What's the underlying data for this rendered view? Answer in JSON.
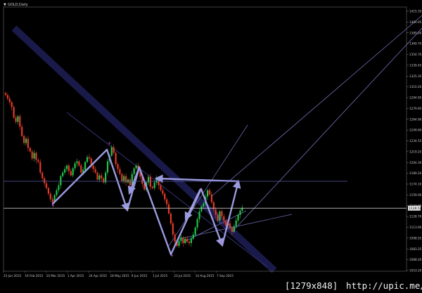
{
  "window": {
    "title": "GOLD,Daily",
    "menu_glyph": "▼"
  },
  "colors": {
    "background": "#000000",
    "bull": "#22c24a",
    "bear": "#e23a2a",
    "pattern": "#9a9adf",
    "trendline": "#34347a",
    "grid": "#dcdcdc"
  },
  "price_axis": {
    "current_price": "1139.53",
    "ticks": [
      "1415.35",
      "1400.05",
      "1385.00",
      "1369.70",
      "1354.70",
      "1339.45",
      "1325.35",
      "1310.20",
      "1294.95",
      "1279.95",
      "1264.90",
      "1249.60",
      "1234.55",
      "1219.25",
      "1204.30",
      "1189.20",
      "1174.10",
      "1159.00",
      "1143.85",
      "1128.70",
      "1113.60",
      "1098.55",
      "1083.25",
      "1068.20",
      "1053.20"
    ]
  },
  "time_axis": {
    "ticks": [
      "23 Jan 2015",
      "16 Feb 2015",
      "10 Mar 2015",
      "1 Apr 2015",
      "24 Apr 2015",
      "18 May 2015",
      "9 Jun 2015",
      "1 Jul 2015",
      "23 Jul 2015",
      "14 Aug 2015",
      "7 Sep 2015"
    ]
  },
  "footer": {
    "resolution": "[1279x848]",
    "site": "http://upic.me/"
  },
  "chart_data": {
    "type": "candlestick",
    "title": "GOLD,Daily",
    "timeframe": "Daily",
    "current_price": 1139.53,
    "ylim": [
      1050,
      1425
    ],
    "x": [
      "23 Jan 2015",
      "16 Feb 2015",
      "10 Mar 2015",
      "1 Apr 2015",
      "24 Apr 2015",
      "18 May 2015",
      "9 Jun 2015",
      "1 Jul 2015",
      "23 Jul 2015",
      "14 Aug 2015",
      "7 Sep 2015"
    ],
    "closes": [
      1300,
      1295,
      1290,
      1283,
      1268,
      1262,
      1270,
      1255,
      1242,
      1232,
      1238,
      1225,
      1220,
      1210,
      1218,
      1208,
      1205,
      1190,
      1182,
      1175,
      1168,
      1160,
      1152,
      1148,
      1158,
      1165,
      1172,
      1185,
      1190,
      1195,
      1200,
      1192,
      1186,
      1196,
      1203,
      1206,
      1200,
      1190,
      1194,
      1205,
      1212,
      1210,
      1200,
      1195,
      1190,
      1180,
      1186,
      1182,
      1176,
      1190,
      1206,
      1214,
      1226,
      1218,
      1202,
      1195,
      1188,
      1178,
      1185,
      1176,
      1180,
      1172,
      1188,
      1196,
      1200,
      1192,
      1184,
      1174,
      1166,
      1176,
      1184,
      1170,
      1168,
      1176,
      1182,
      1172,
      1165,
      1160,
      1152,
      1145,
      1132,
      1118,
      1102,
      1092,
      1086,
      1093,
      1098,
      1090,
      1096,
      1092,
      1090,
      1096,
      1102,
      1112,
      1124,
      1135,
      1142,
      1146,
      1156,
      1165,
      1159,
      1148,
      1138,
      1130,
      1122,
      1135,
      1128,
      1122,
      1115,
      1118,
      1112,
      1106,
      1114,
      1122,
      1130,
      1136,
      1140
    ],
    "pivots": [
      "11 Mar 2015",
      "18 May 2015",
      "5 Jun 2015",
      "17 Jun 2015",
      "24 Jul 2015",
      "24 Aug 2015",
      "11 Sep 2015"
    ],
    "horizontal_levels": [
      1180,
      1139.53
    ]
  }
}
